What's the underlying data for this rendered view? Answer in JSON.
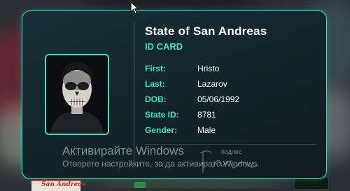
{
  "card": {
    "title": "State of San Andreas",
    "subtitle": "ID CARD",
    "fields": [
      {
        "label": "First:",
        "value": "Hristo"
      },
      {
        "label": "Last:",
        "value": "Lazarov"
      },
      {
        "label": "DOB:",
        "value": "05/06/1992"
      },
      {
        "label": "State ID:",
        "value": "8781"
      },
      {
        "label": "Gender:",
        "value": "Male"
      }
    ],
    "signature_label": "подпис",
    "accent_color": "#2ee8b9",
    "photo_icon": "skull-face-portrait"
  },
  "windows_watermark": {
    "title": "Активирайте Windows",
    "subtitle": "Отворете настройките, за да активирате Windows."
  },
  "background_sign": "San Andreas"
}
